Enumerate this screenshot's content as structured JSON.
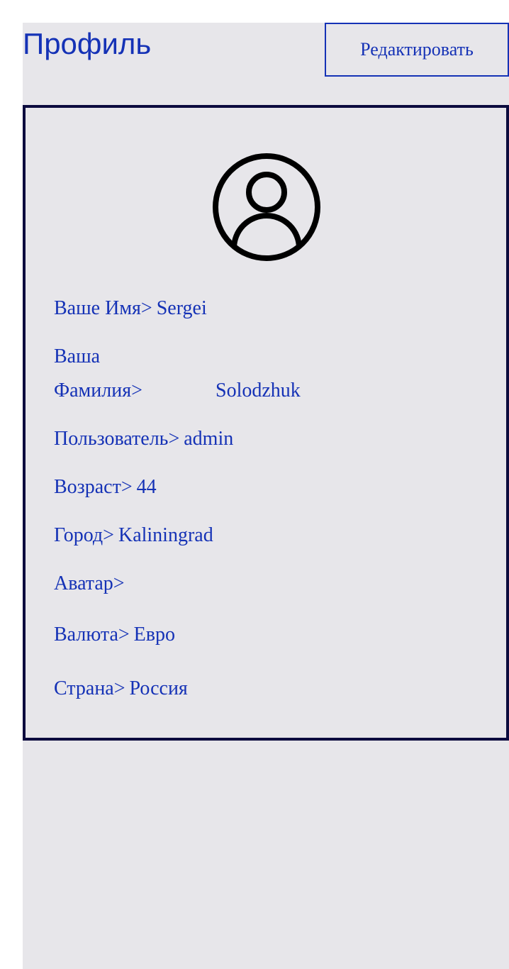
{
  "header": {
    "title": "Профиль",
    "edit_label": "Редактировать"
  },
  "profile": {
    "avatar_icon": "user-circle-icon",
    "fields": {
      "name": {
        "label": "Ваше Имя>",
        "value": "Sergei"
      },
      "surname": {
        "label_line1": "Ваша",
        "label_line2": "Фамилия>",
        "value": "Solodzhuk"
      },
      "user": {
        "label": "Пользователь>",
        "value": "admin"
      },
      "age": {
        "label": "Возраст>",
        "value": "44"
      },
      "city": {
        "label": "Город>",
        "value": "Kaliningrad"
      },
      "avatar": {
        "label": "Аватар>"
      },
      "currency": {
        "label": "Валюта>",
        "value": "Евро"
      },
      "country": {
        "label": "Страна>",
        "value": "Россия"
      }
    }
  },
  "colors": {
    "accent": "#1532b6",
    "card_border": "#0c0b3e",
    "background": "#e7e6ea"
  }
}
